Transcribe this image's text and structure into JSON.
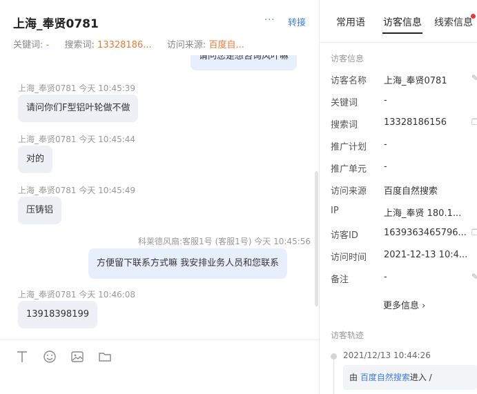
{
  "header": {
    "title": "上海_奉贤0781",
    "more_label": "···",
    "transfer_label": "转接",
    "keyword_label": "关键词:",
    "keyword_value": "-",
    "search_label": "搜索词:",
    "search_value": "13328186...",
    "source_label": "访问来源:",
    "source_value": "百度自..."
  },
  "messages": {
    "m0_text": "请问您是想咨询风叶嘛",
    "m1_sender": "上海_奉贤0781 今天 10:45:39",
    "m1_text": "请问你们F型铝叶轮做不做",
    "m2_sender": "上海_奉贤0781 今天 10:45:44",
    "m2_text": "对的",
    "m3_sender": "上海_奉贤0781 今天 10:45:49",
    "m3_text": "压铸铝",
    "m4_sender": "科莱德风扇:客服1号 (客服1号) 今天 10:45:56",
    "m4_text": "方便留下联系方式嘛  我安排业务人员和您联系",
    "m5_sender": "上海_奉贤0781 今天 10:46:08",
    "m5_text": "13918398199"
  },
  "toolbar": {
    "text_icon": "text-format-icon",
    "emoji_icon": "emoji-icon",
    "image_icon": "image-icon",
    "folder_icon": "folder-icon"
  },
  "side": {
    "tabs": [
      "常用语",
      "访客信息",
      "线索信息"
    ],
    "section_visitor": "访客信息",
    "rows": [
      {
        "label": "访客名称",
        "value": "上海_奉贤0781"
      },
      {
        "label": "关键词",
        "value": "-"
      },
      {
        "label": "搜索词",
        "value": "13328186156"
      },
      {
        "label": "推广计划",
        "value": "-"
      },
      {
        "label": "推广单元",
        "value": "-"
      },
      {
        "label": "访问来源",
        "value": "百度自然搜索"
      },
      {
        "label": "IP",
        "value": "上海_奉贤 180.1..."
      },
      {
        "label": "访客ID",
        "value": "1639363465796..."
      },
      {
        "label": "访问时间",
        "value": "2021-12-13 10:4..."
      },
      {
        "label": "备注",
        "value": "-"
      }
    ],
    "more_info": "更多信息 ›",
    "section_track": "访客轨迹",
    "track_time": "2021/12/13 10:44:26",
    "track_prefix": "由 ",
    "track_link": "百度自然搜索",
    "track_suffix": "进入 /"
  },
  "colors": {
    "accent": "#3b7ddd",
    "orange": "#e8793a",
    "badge_red": "#e53935"
  }
}
